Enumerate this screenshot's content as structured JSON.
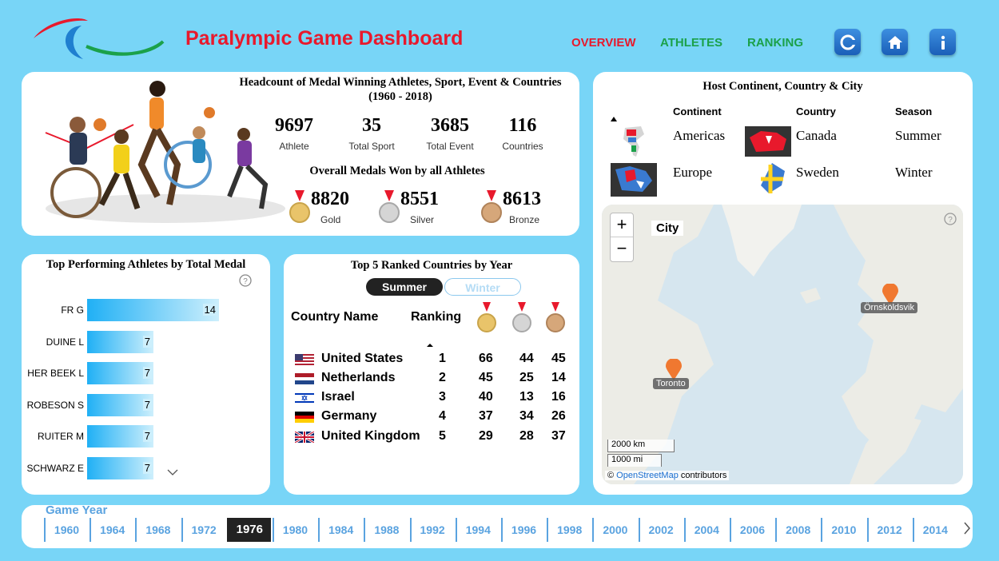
{
  "header": {
    "title": "Paralympic Game Dashboard",
    "nav": [
      "OVERVIEW",
      "ATHLETES",
      "RANKING"
    ],
    "nav_colors": [
      "#e8192c",
      "#1ba14a",
      "#1ba14a"
    ]
  },
  "headcount": {
    "title": "Headcount of Medal Winning Athletes, Sport, Event & Countries (1960 - 2018)",
    "kpis": [
      {
        "value": "9697",
        "label": "Athlete"
      },
      {
        "value": "35",
        "label": "Total Sport"
      },
      {
        "value": "3685",
        "label": "Total Event"
      },
      {
        "value": "116",
        "label": "Countries"
      }
    ],
    "medals_title": "Overall Medals Won by all  Athletes",
    "medals": [
      {
        "value": "8820",
        "label": "Gold",
        "color": "#e9c46a"
      },
      {
        "value": "8551",
        "label": "Silver",
        "color": "#c7c7c7"
      },
      {
        "value": "8613",
        "label": "Bronze",
        "color": "#d6a77a"
      }
    ]
  },
  "top_athletes": {
    "title": "Top Performing Athletes by Total Medal",
    "max": 14,
    "rows": [
      {
        "name": "FR G",
        "value": "14",
        "n": 14
      },
      {
        "name": "DUINE L",
        "value": "7",
        "n": 7
      },
      {
        "name": "HER BEEK L",
        "value": "7",
        "n": 7
      },
      {
        "name": "ROBESON S",
        "value": "7",
        "n": 7
      },
      {
        "name": "RUITER M",
        "value": "7",
        "n": 7
      },
      {
        "name": "SCHWARZ E",
        "value": "7",
        "n": 7
      }
    ]
  },
  "ranked": {
    "title": "Top 5 Ranked Countries by Year",
    "toggle": {
      "summer": "Summer",
      "winter": "Winter"
    },
    "col_country": "Country Name",
    "col_ranking": "Ranking",
    "rows": [
      {
        "country": "United States",
        "rank": "1",
        "gold": "66",
        "silver": "44",
        "bronze": "45",
        "flag": "us"
      },
      {
        "country": "Netherlands",
        "rank": "2",
        "gold": "45",
        "silver": "25",
        "bronze": "14",
        "flag": "nl"
      },
      {
        "country": "Israel",
        "rank": "3",
        "gold": "40",
        "silver": "13",
        "bronze": "16",
        "flag": "il"
      },
      {
        "country": "Germany",
        "rank": "4",
        "gold": "37",
        "silver": "34",
        "bronze": "26",
        "flag": "de"
      },
      {
        "country": "United Kingdom",
        "rank": "5",
        "gold": "29",
        "silver": "28",
        "bronze": "37",
        "flag": "gb"
      }
    ]
  },
  "host": {
    "title": "Host Continent, Country & City",
    "col_continent": "Continent",
    "col_country": "Country",
    "col_season": "Season",
    "rows": [
      {
        "continent": "Americas",
        "country": "Canada",
        "season": "Summer"
      },
      {
        "continent": "Europe",
        "country": "Sweden",
        "season": "Winter"
      }
    ],
    "map": {
      "legend": "City",
      "cities": [
        "Örnsköldsvik",
        "Toronto"
      ],
      "scale_km": "2000 km",
      "scale_mi": "1000 mi",
      "attribution_link": "OpenStreetMap",
      "attribution_rest": " contributors",
      "zoom_in": "+",
      "zoom_out": "−"
    }
  },
  "years": {
    "label": "Game Year",
    "selected": "1976",
    "items": [
      "1960",
      "1964",
      "1968",
      "1972",
      "1976",
      "1980",
      "1984",
      "1988",
      "1992",
      "1994",
      "1996",
      "1998",
      "2000",
      "2002",
      "2004",
      "2006",
      "2008",
      "2010",
      "2012",
      "2014"
    ]
  }
}
